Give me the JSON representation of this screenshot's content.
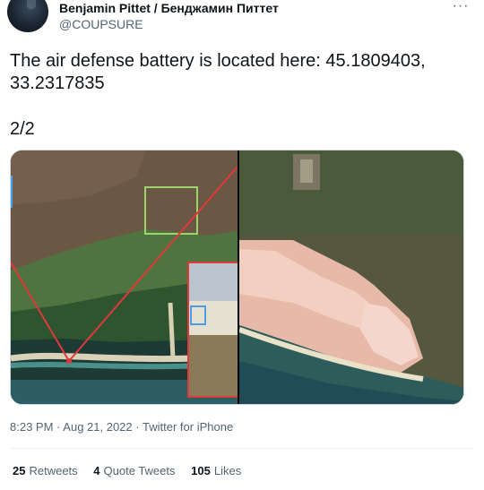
{
  "author": {
    "display_name": "Benjamin Pittet / Бенджамин Питтет",
    "handle": "@COUPSURE",
    "avatar_icon": "profile-avatar"
  },
  "more_icon": "more-dots-icon",
  "tweet": {
    "text_line_1": "The air defense battery is located here: 45.1809403,",
    "text_line_2": "33.2317835",
    "counter": "2/2"
  },
  "media": {
    "left_image_alt": "satellite-map-left",
    "right_image_alt": "satellite-map-right",
    "annotation_color": "#e0383b",
    "highlight_color": "#9ad46a",
    "inset_box_color": "#4a9ee6"
  },
  "meta": {
    "time": "8:23 PM",
    "separator_1": "·",
    "date": "Aug 21, 2022",
    "separator_2": "·",
    "source": "Twitter for iPhone"
  },
  "stats": {
    "retweets_count": "25",
    "retweets_label": "Retweets",
    "quotes_count": "4",
    "quotes_label": "Quote Tweets",
    "likes_count": "105",
    "likes_label": "Likes"
  }
}
